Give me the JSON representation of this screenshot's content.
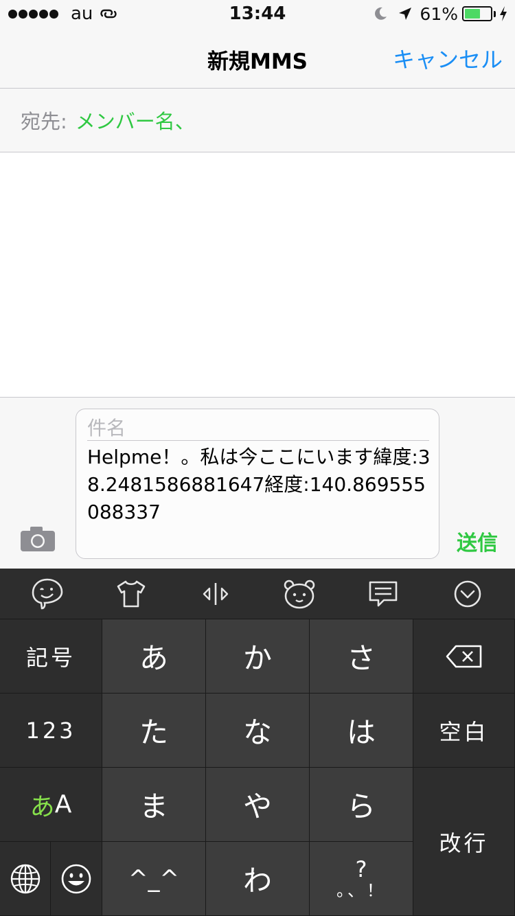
{
  "status_bar": {
    "carrier": "au",
    "time": "13:44",
    "battery_percent": "61%",
    "battery_level": 0.61,
    "signal_dots": 5
  },
  "nav": {
    "title": "新規MMS",
    "cancel_label": "キャンセル"
  },
  "recipient": {
    "label": "宛先:",
    "value": "メンバー名、"
  },
  "compose": {
    "subject_placeholder": "件名",
    "body": "Helpme！。私は今ここにいます緯度:38.2481586881647経度:140.869555088337",
    "send_label": "送信"
  },
  "keyboard_toolbar": {
    "icons": [
      "emoji-face-icon",
      "shirt-icon",
      "cursor-move-icon",
      "bear-face-icon",
      "message-icon",
      "chevron-down-icon"
    ]
  },
  "keyboard": {
    "symbols_label": "記号",
    "numbers_label": "123",
    "mode_kana": "あ",
    "mode_alpha": "A",
    "space_label": "空白",
    "return_label": "改行",
    "emoticon_label": "^_^",
    "punct_top": "?",
    "punct_bottom": "。、！",
    "kana": {
      "a": "あ",
      "ka": "か",
      "sa": "さ",
      "ta": "た",
      "na": "な",
      "ha": "は",
      "ma": "ま",
      "ya": "や",
      "ra": "ら",
      "wa": "わ"
    }
  },
  "colors": {
    "accent_blue": "#1a8ef5",
    "accent_green": "#2fc842",
    "keyboard_dark": "#2d2d2d",
    "keyboard_key": "#3d3d3d"
  }
}
